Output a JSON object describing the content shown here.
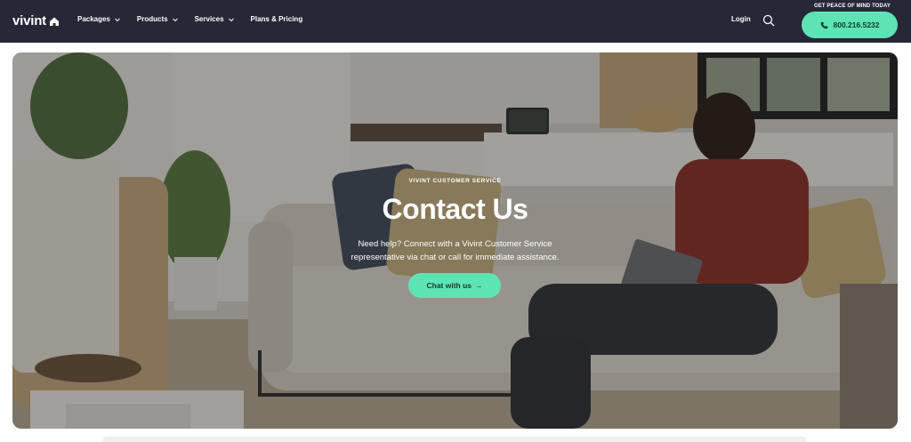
{
  "header": {
    "logo": "vivint",
    "nav": [
      {
        "label": "Packages",
        "has_dropdown": true
      },
      {
        "label": "Products",
        "has_dropdown": true
      },
      {
        "label": "Services",
        "has_dropdown": true
      },
      {
        "label": "Plans & Pricing",
        "has_dropdown": false
      }
    ],
    "login": "Login",
    "promo": "GET PEACE OF MIND TODAY",
    "phone": "800.216.5232"
  },
  "hero": {
    "eyebrow": "VIVINT CUSTOMER SERVICE",
    "title": "Contact Us",
    "desc_line1": "Need help? Connect with a Vivint Customer Service",
    "desc_line2": "representative via chat or call for immediate assistance.",
    "cta": "Chat with us",
    "cta_arrow": "→"
  },
  "colors": {
    "header_bg": "#262737",
    "accent": "#5ee4b4",
    "accent_text": "#0f3b30"
  },
  "icons": [
    "home-icon",
    "chevron-down-icon",
    "search-icon",
    "phone-icon",
    "arrow-right-icon"
  ]
}
